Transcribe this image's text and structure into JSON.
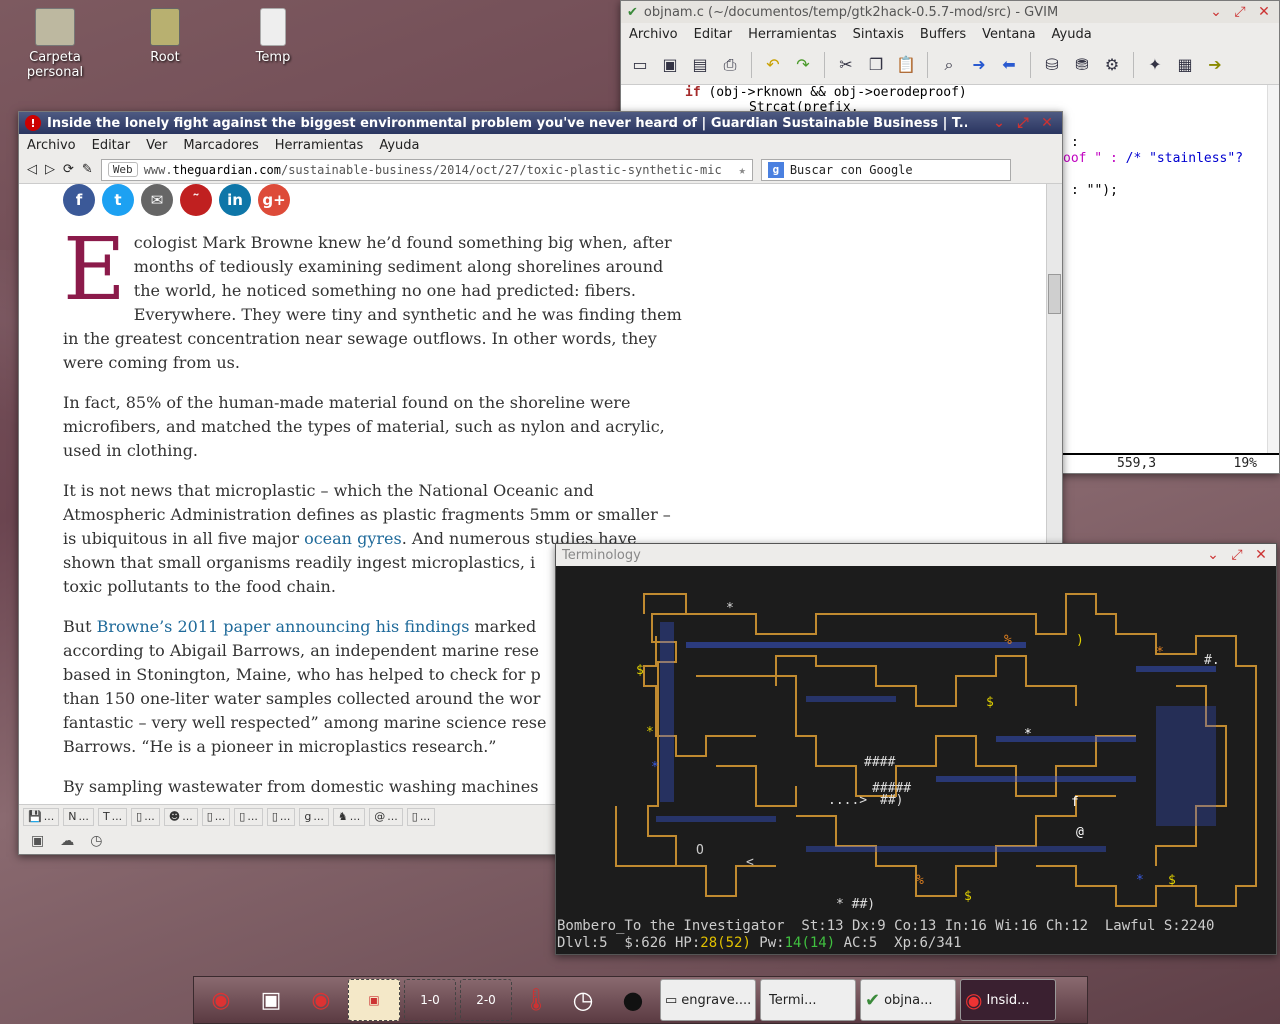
{
  "desktop": {
    "icons": [
      {
        "label": "Carpeta personal",
        "icon": "home-folder-icon"
      },
      {
        "label": "Root",
        "icon": "drawer-icon"
      },
      {
        "label": "Temp",
        "icon": "temp-folder-icon"
      }
    ]
  },
  "gvim": {
    "title": "objnam.c (~/documentos/temp/gtk2hack-0.5.7-mod/src) - GVIM",
    "menu": [
      "Archivo",
      "Editar",
      "Herramientas",
      "Sintaxis",
      "Buffers",
      "Ventana",
      "Ayuda"
    ],
    "lines": {
      "l1_kw": "if",
      "l1_rest": " (obj->rknown && obj->oerodeproof)",
      "l2": "Strcat(prefix,",
      "l3": ":",
      "l4_str": "oof \" :",
      "l4_cmt": "/* \"stainless\"?",
      "l5": ": \"\");"
    },
    "status_pos": "559,3",
    "status_pct": "19%"
  },
  "browser": {
    "title": "Inside the lonely fight against the biggest environmental problem you've never heard of | Guardian Sustainable Business | T...",
    "menu": [
      "Archivo",
      "Editar",
      "Ver",
      "Marcadores",
      "Herramientas",
      "Ayuda"
    ],
    "web_label": "Web",
    "url_prefix": "www.",
    "url_domain": "theguardian.com",
    "url_path": "/sustainable-business/2014/oct/27/toxic-plastic-synthetic-mic",
    "search_placeholder": "Buscar con Google",
    "article": {
      "dropcap": "E",
      "p1": "cologist Mark Browne knew he’d found something big when, after months of tediously examining sediment along shorelines around the world, he noticed something no one had predicted: fibers. Everywhere. They were tiny and synthetic and he was finding them in the greatest concentration near sewage outflows. In other words, they were coming from us.",
      "p2": "In fact, 85% of the human-made material found on the shoreline were microfibers, and matched the types of material, such as nylon and acrylic, used in clothing.",
      "p3a": "It is not news that microplastic – which the National Oceanic and Atmospheric Administration defines as plastic fragments 5mm or smaller – is ubiquitous in all five major ",
      "p3link": "ocean gyres",
      "p3b": ". And numerous studies have shown that small organisms readily ingest microplastics, i",
      "p3c": "toxic pollutants to the food chain.",
      "p4a": "But ",
      "p4link": "Browne’s 2011 paper announcing his findings",
      "p4b": " marked",
      "p4c": "according to Abigail Barrows, an independent marine rese",
      "p4d": "based in Stonington, Maine, who has helped to check for p",
      "p4e": "than 150 one-liter water samples collected around the wor",
      "p4f": "fantastic – very well respected” among marine science rese",
      "p4g": "Barrows. “He is a pioneer in microplastics research.”",
      "p5": "By sampling wastewater from domestic washing machines"
    },
    "status_tabs": [
      "...",
      "...",
      "...",
      "...",
      "...",
      "...",
      "...",
      "...",
      "...",
      "...",
      "...",
      "..."
    ]
  },
  "terminal": {
    "title": "Terminology",
    "status_line1": "Bombero_To the Investigator  St:13 Dx:9 Co:13 In:16 Wi:16 Ch:12  Lawful S:2240",
    "status_line2_a": "Dlvl:5  $:626 HP:",
    "status_hp": "28(52)",
    "status_line2_b": " Pw:",
    "status_pw": "14(14)",
    "status_line2_c": " AC:5  Xp:6/341"
  },
  "taskbar": {
    "pager1": "1-0",
    "pager2": "2-0",
    "tasks": [
      {
        "label": "engrave....",
        "icon": "window-icon"
      },
      {
        "label": "Termi...",
        "icon": "terminal-icon"
      },
      {
        "label": "objna...",
        "icon": "vim-icon"
      },
      {
        "label": "Insid...",
        "icon": "opera-icon"
      }
    ]
  },
  "colors": {
    "dropcap": "#8b1a4a",
    "link": "#1f6a9a",
    "map_wall": "#c08a30",
    "map_floor": "#3a5adf"
  }
}
